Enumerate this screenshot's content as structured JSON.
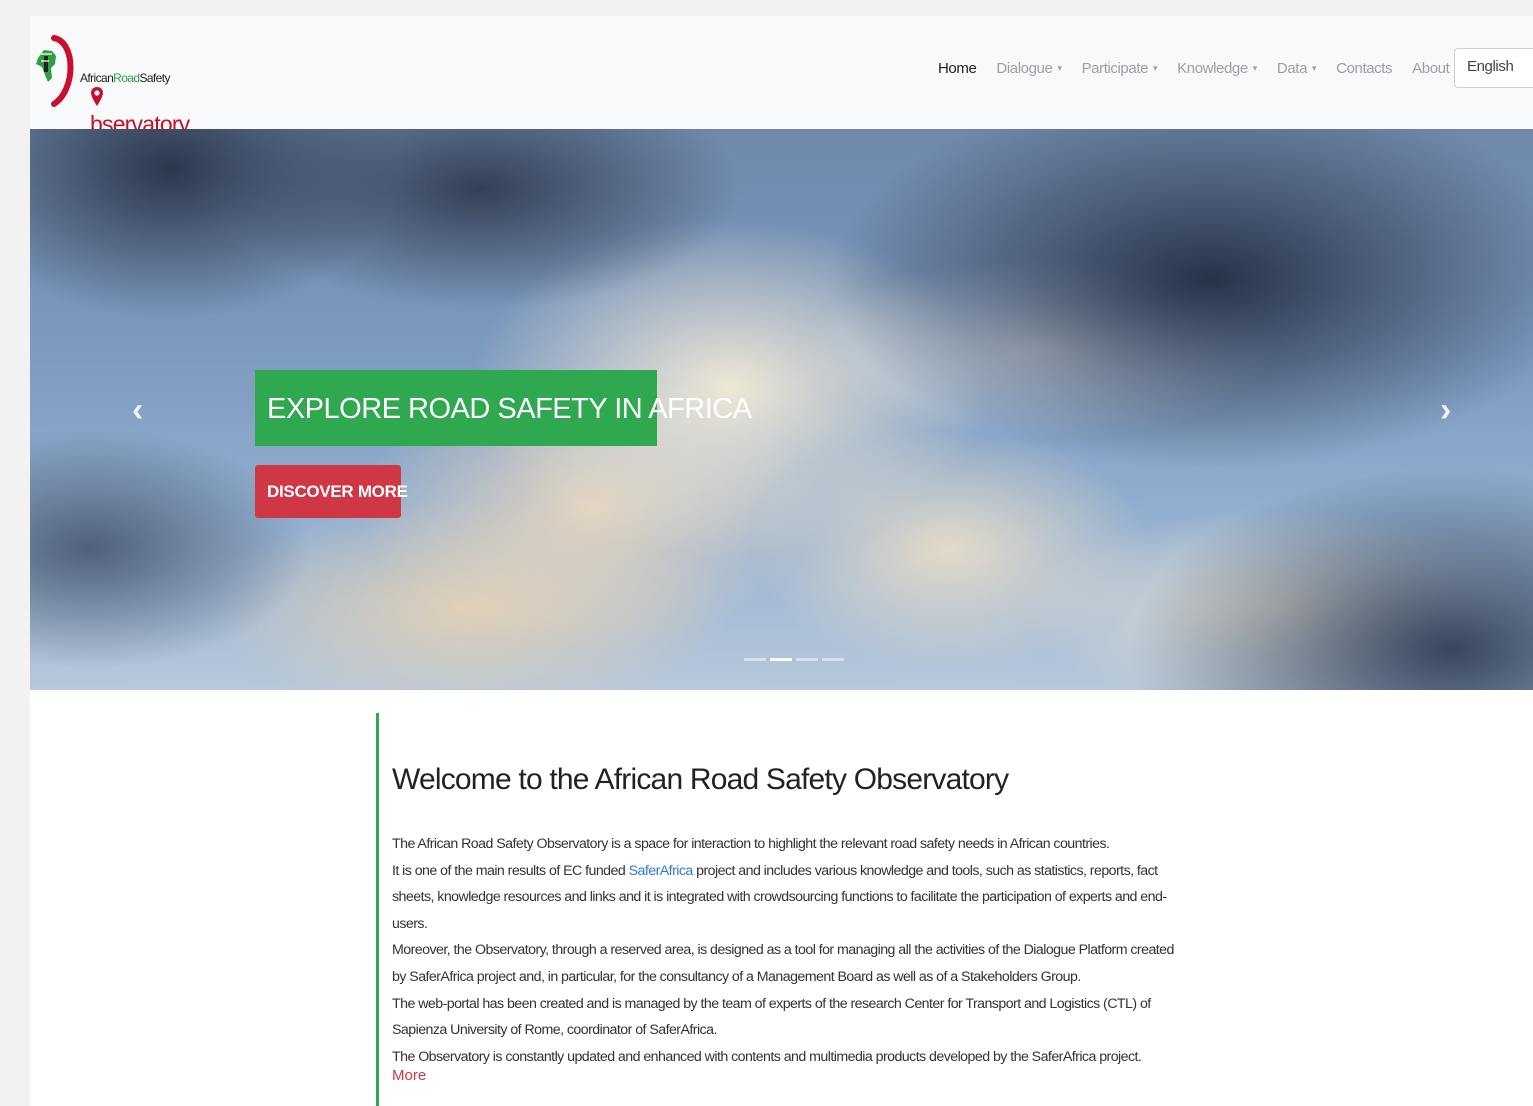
{
  "logo": {
    "line1_a": "African",
    "line1_b": "Road",
    "line1_c": "Safety",
    "line2": "bservatory"
  },
  "nav": {
    "items": [
      {
        "label": "Home",
        "dropdown": false
      },
      {
        "label": "Dialogue",
        "dropdown": true
      },
      {
        "label": "Participate",
        "dropdown": true
      },
      {
        "label": "Knowledge",
        "dropdown": true
      },
      {
        "label": "Data",
        "dropdown": true
      },
      {
        "label": "Contacts",
        "dropdown": false
      },
      {
        "label": "About",
        "dropdown": false
      }
    ],
    "caret": "▾",
    "language": "English"
  },
  "carousel": {
    "title": "EXPLORE ROAD SAFETY IN AFRICA",
    "button": "DISCOVER MORE",
    "prev": "‹",
    "next": "›",
    "slide_count": 4,
    "active_slide": 2
  },
  "welcome": {
    "title": "Welcome to the African Road Safety Observatory",
    "p1": "The African Road Safety Observatory is a space for interaction to highlight the relevant road safety needs in African countries.",
    "p2_a": "It is one of the main results of EC funded ",
    "p2_link": "SaferAfrica",
    "p2_b": " project and includes various knowledge and tools, such as statistics, reports, fact sheets, knowledge resources and links and it is integrated with crowdsourcing functions to facilitate the participation of experts and end-users.",
    "p3": "Moreover, the Observatory, through a reserved area, is designed as a tool for managing all the activities of the Dialogue Platform created by SaferAfrica project and, in particular, for the consultancy of a Management Board as well as of a Stakeholders Group.",
    "p4": "The web-portal has been created and is managed by the team of experts of the research Center for Transport and Logistics (CTL) of Sapienza University of Rome, coordinator of SaferAfrica.",
    "p5": "The Observatory is constantly updated and enhanced with contents and multimedia products developed by the SaferAfrica project.",
    "more": "More"
  },
  "colors": {
    "green": "#2fa84f",
    "red": "#d03744",
    "link": "#2a7bd6"
  }
}
